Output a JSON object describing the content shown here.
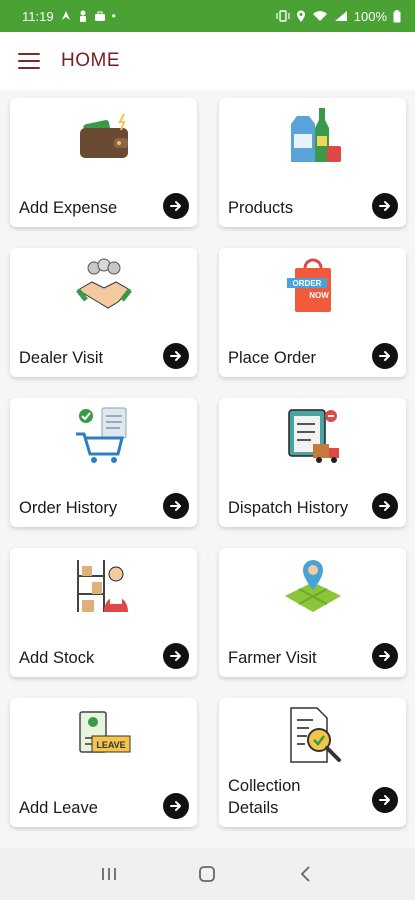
{
  "status_bar": {
    "time": "11:19",
    "battery": "100%",
    "left_icons": [
      "navigation-icon",
      "person-icon",
      "bag-icon",
      "dot-icon"
    ],
    "right_icons": [
      "vibrate-icon",
      "location-icon",
      "wifi-icon",
      "signal-icon",
      "battery-icon"
    ]
  },
  "app_bar": {
    "title": "HOME",
    "menu_icon": "hamburger-menu-icon"
  },
  "tiles": [
    {
      "label": "Add Expense",
      "icon": "wallet-icon"
    },
    {
      "label": "Products",
      "icon": "grocery-products-icon"
    },
    {
      "label": "Dealer Visit",
      "icon": "handshake-icon"
    },
    {
      "label": "Place Order",
      "icon": "order-now-bag-icon",
      "icon_text": [
        "ORDER",
        "NOW"
      ]
    },
    {
      "label": "Order History",
      "icon": "cart-checklist-icon"
    },
    {
      "label": "Dispatch History",
      "icon": "clipboard-truck-icon"
    },
    {
      "label": "Add Stock",
      "icon": "stock-shelf-person-icon"
    },
    {
      "label": "Farmer Visit",
      "icon": "field-map-pin-icon"
    },
    {
      "label": "Add Leave",
      "icon": "leave-id-card-icon",
      "icon_text": [
        "LEAVE"
      ]
    },
    {
      "label": "Collection Details",
      "icon": "document-search-icon"
    }
  ],
  "colors": {
    "status_bar": "#4aa235",
    "title": "#7a1f1f",
    "arrow_button": "#111111"
  },
  "nav_bar": {
    "icons": [
      "recent-apps-icon",
      "home-icon",
      "back-icon"
    ]
  }
}
